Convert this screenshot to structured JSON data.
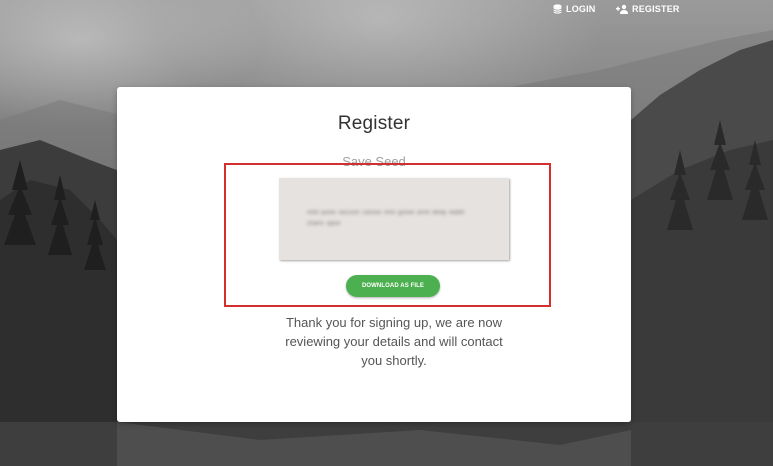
{
  "nav": {
    "login_label": "LOGIN",
    "register_label": "REGISTER"
  },
  "card": {
    "title": "Register",
    "section_title": "Save Seed",
    "seed_text": "orbit pulse raccoon canvas mint goose anvil delay wallet charm spice",
    "download_label": "DOWNLOAD AS FILE",
    "thanks_message": "Thank you for signing up, we are now reviewing your details and will contact you shortly."
  },
  "colors": {
    "accent_green": "#4caf50",
    "highlight_red": "#d32f2f",
    "card_bg": "#ffffff",
    "seed_bg": "#e6e2e0"
  },
  "icons": {
    "login": "database-icon",
    "register": "add-user-icon"
  }
}
